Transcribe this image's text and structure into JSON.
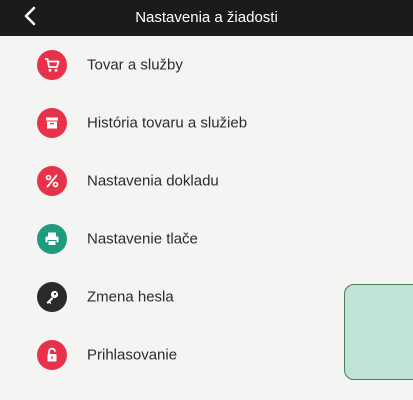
{
  "header": {
    "title": "Nastavenia a žiadosti",
    "back_icon": "chevron-left-icon"
  },
  "colors": {
    "header_bg": "#1b1b1b",
    "red": "#e8314b",
    "teal": "#1e9a7c",
    "dark": "#2a2a2a",
    "panel_bg": "#bfe3d5"
  },
  "menu": {
    "items": [
      {
        "label": "Tovar a služby",
        "icon": "cart-icon",
        "color": "#e8314b"
      },
      {
        "label": "História tovaru a služieb",
        "icon": "archive-box-icon",
        "color": "#e8314b"
      },
      {
        "label": "Nastavenia dokladu",
        "icon": "percent-icon",
        "color": "#e8314b"
      },
      {
        "label": "Nastavenie tlače",
        "icon": "printer-icon",
        "color": "#1e9a7c"
      },
      {
        "label": "Zmena hesla",
        "icon": "key-icon",
        "color": "#2a2a2a"
      },
      {
        "label": "Prihlasovanie",
        "icon": "unlock-icon",
        "color": "#e8314b"
      }
    ]
  }
}
